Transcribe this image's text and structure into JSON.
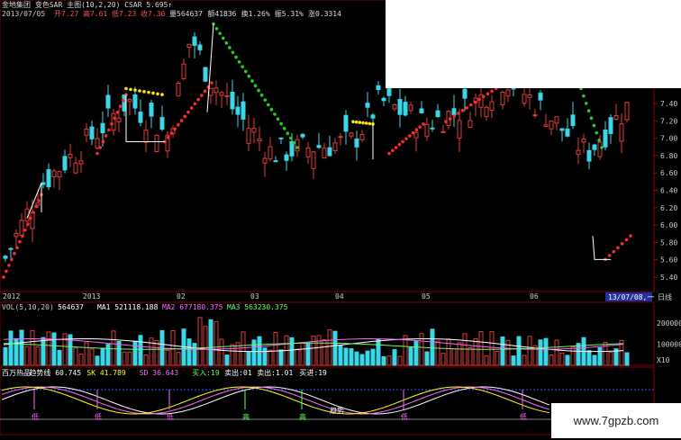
{
  "main_header": {
    "stock": "金地集团",
    "indicator": "变色SAR 主图",
    "params": "(10,2,20)",
    "csar_label": "CSAR 5.695↑",
    "row2": [
      "2013/07/05",
      "开7.27",
      "高7.61",
      "低7.23",
      "收7.30",
      "量564637",
      "额41836",
      "换1.26%",
      "振5.31%",
      "涨0.3314"
    ]
  },
  "price_axis": {
    "ticks": [
      "7.40",
      "7.20",
      "7.00",
      "6.80",
      "6.60",
      "6.40",
      "6.20",
      "6.00",
      "5.80",
      "5.60",
      "5.40"
    ]
  },
  "date_axis": {
    "ticks": [
      "2012",
      "2013",
      "02",
      "03",
      "04",
      "05",
      "06"
    ],
    "current": "13/07/08,一",
    "period": "日线"
  },
  "volume_header": {
    "title": "VOL(5,10,20)",
    "value": "564637",
    "ma1": "MA1 521118.188",
    "ma2": "MA2 677180.375",
    "ma3": "MA3 563230.375"
  },
  "volume_axis": {
    "ticks": [
      "200000",
      "100000"
    ],
    "unit": "X10"
  },
  "osc_header": {
    "name": "百万热品",
    "line1": "趋势线 60.745",
    "line2": "SK 41.789",
    "line3": "SD 36.643",
    "buy": "买入:19",
    "sell": "卖出:01",
    "sell2": "卖出:1.01",
    "buy2": "买进:19"
  },
  "osc_labels": {
    "low": "低",
    "high": "高",
    "mid": "趋势"
  },
  "watermark": "www.7gpzb.com",
  "colors": {
    "up": "#e03a3a",
    "down": "#3ad7e8",
    "sar_red": "#ff2b2b",
    "sar_green": "#22d322",
    "sar_yellow": "#ffe600"
  },
  "chart_data": {
    "type": "candlestick",
    "x": [
      "2012-12",
      "2013-01",
      "2013-02",
      "2013-03",
      "2013-04",
      "2013-05",
      "2013-06",
      "2013-07"
    ],
    "price_close_approx": [
      5.75,
      6.3,
      7.0,
      6.6,
      6.4,
      6.85,
      6.7,
      7.3
    ],
    "sar_phases": [
      {
        "trend": "up",
        "color": "red"
      },
      {
        "trend": "top",
        "color": "yellow"
      },
      {
        "trend": "down",
        "color": "green"
      },
      {
        "trend": "up",
        "color": "red"
      }
    ],
    "volume_ma": {
      "ma1": 521118.188,
      "ma2": 677180.375,
      "ma3": 563230.375
    },
    "ylim_price": [
      5.4,
      7.4
    ]
  }
}
